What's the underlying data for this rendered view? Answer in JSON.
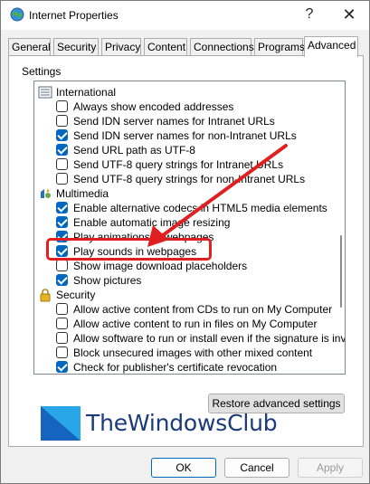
{
  "window": {
    "title": "Internet Properties",
    "help_glyph": "?",
    "close_glyph": "✕"
  },
  "tabs": [
    {
      "label": "General"
    },
    {
      "label": "Security"
    },
    {
      "label": "Privacy"
    },
    {
      "label": "Content"
    },
    {
      "label": "Connections"
    },
    {
      "label": "Programs"
    },
    {
      "label": "Advanced"
    }
  ],
  "active_tab": "Advanced",
  "settings_label": "Settings",
  "settings_list": [
    {
      "kind": "category",
      "icon": "globe-icon",
      "label": "International"
    },
    {
      "kind": "checkbox",
      "checked": false,
      "label": "Always show encoded addresses"
    },
    {
      "kind": "checkbox",
      "checked": false,
      "label": "Send IDN server names for Intranet URLs"
    },
    {
      "kind": "checkbox",
      "checked": true,
      "label": "Send IDN server names for non-Intranet URLs"
    },
    {
      "kind": "checkbox",
      "checked": true,
      "label": "Send URL path as UTF-8"
    },
    {
      "kind": "checkbox",
      "checked": false,
      "label": "Send UTF-8 query strings for Intranet URLs"
    },
    {
      "kind": "checkbox",
      "checked": false,
      "label": "Send UTF-8 query strings for non-Intranet URLs"
    },
    {
      "kind": "category",
      "icon": "multimedia-icon",
      "label": "Multimedia"
    },
    {
      "kind": "checkbox",
      "checked": true,
      "label": "Enable alternative codecs in HTML5 media elements"
    },
    {
      "kind": "checkbox",
      "checked": true,
      "label": "Enable automatic image resizing"
    },
    {
      "kind": "checkbox",
      "checked": true,
      "label": "Play animations in webpages"
    },
    {
      "kind": "checkbox",
      "checked": true,
      "label": "Play sounds in webpages"
    },
    {
      "kind": "checkbox",
      "checked": false,
      "label": "Show image download placeholders"
    },
    {
      "kind": "checkbox",
      "checked": true,
      "label": "Show pictures"
    },
    {
      "kind": "category",
      "icon": "lock-icon",
      "label": "Security"
    },
    {
      "kind": "checkbox",
      "checked": false,
      "label": "Allow active content from CDs to run on My Computer"
    },
    {
      "kind": "checkbox",
      "checked": false,
      "label": "Allow active content to run in files on My Computer"
    },
    {
      "kind": "checkbox",
      "checked": false,
      "label": "Allow software to run or install even if the signature is inva"
    },
    {
      "kind": "checkbox",
      "checked": false,
      "label": "Block unsecured images with other mixed content"
    },
    {
      "kind": "checkbox",
      "checked": true,
      "label": "Check for publisher's certificate revocation"
    }
  ],
  "restore_button": "Restore advanced settings",
  "watermark": "TheWindowsClub",
  "buttons": {
    "ok": "OK",
    "cancel": "Cancel",
    "apply": "Apply"
  },
  "colors": {
    "checkbox_checked": "#0067c0",
    "annotation_red": "#e02020",
    "watermark_blue": "#1a3a7a"
  }
}
